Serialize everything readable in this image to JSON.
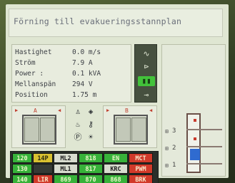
{
  "title": "Förning till evakueringsstannplan",
  "readout": [
    {
      "label": "Hastighet",
      "value": "0.0 m/s"
    },
    {
      "label": "Ström",
      "value": "7.9 A"
    },
    {
      "label": "Power   :",
      "value": "0.1 kVA"
    },
    {
      "label": "Mellanspän",
      "value": "294 V"
    },
    {
      "label": "Position",
      "value": "1.75 m"
    }
  ],
  "side_icons": [
    {
      "name": "ac-wave-icon",
      "glyph": "∿"
    },
    {
      "name": "transistor-icon",
      "glyph": "⊳"
    },
    {
      "name": "battery-icon",
      "glyph": "▮▮"
    },
    {
      "name": "plug-icon",
      "glyph": "⊸"
    }
  ],
  "doors": {
    "a_label": "A",
    "b_label": "B"
  },
  "floors": [
    {
      "num": "3"
    },
    {
      "num": "2"
    },
    {
      "num": "1"
    }
  ],
  "status": [
    {
      "text": "120",
      "color": "green"
    },
    {
      "text": "14P",
      "color": "yellow"
    },
    {
      "text": "ML2",
      "color": "white"
    },
    {
      "text": "818",
      "color": "green"
    },
    {
      "text": "EN",
      "color": "green"
    },
    {
      "text": "MCT",
      "color": "red"
    },
    {
      "text": "130",
      "color": "green"
    },
    {
      "text": "",
      "color": "dark"
    },
    {
      "text": "ML1",
      "color": "white"
    },
    {
      "text": "817",
      "color": "green"
    },
    {
      "text": "KRC",
      "color": "white"
    },
    {
      "text": "PWM",
      "color": "red"
    },
    {
      "text": "140",
      "color": "green"
    },
    {
      "text": "LIR",
      "color": "red"
    },
    {
      "text": "869",
      "color": "green"
    },
    {
      "text": "870",
      "color": "green"
    },
    {
      "text": "868",
      "color": "green"
    },
    {
      "text": "BRK",
      "color": "red"
    }
  ]
}
